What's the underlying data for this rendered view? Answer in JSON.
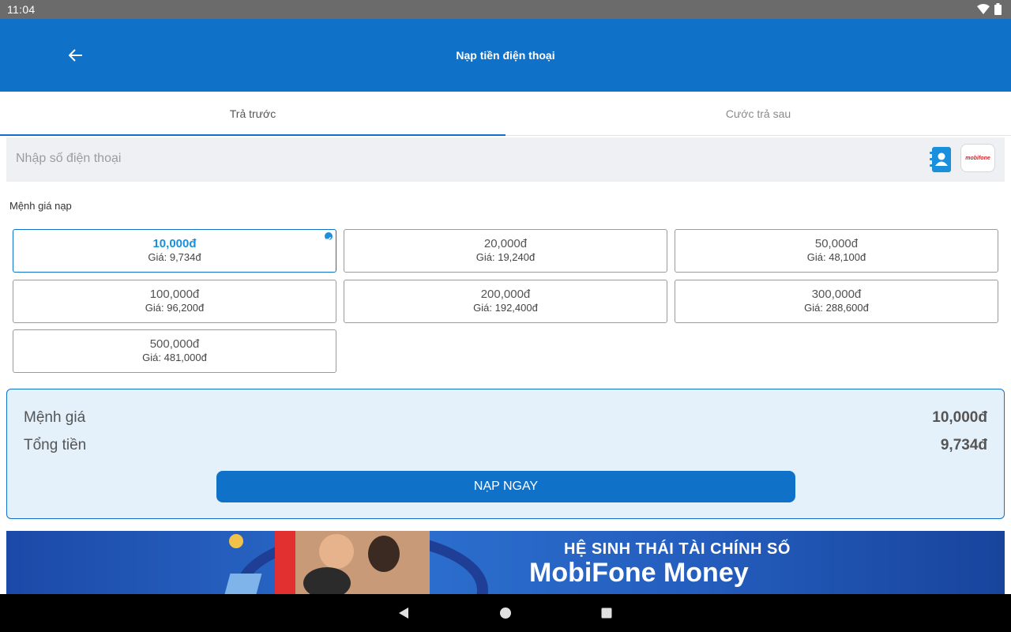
{
  "status": {
    "time": "11:04"
  },
  "header": {
    "title": "Nạp tiền điện thoại"
  },
  "tabs": [
    {
      "label": "Trả trước",
      "active": true
    },
    {
      "label": "Cước trả sau",
      "active": false
    }
  ],
  "phone": {
    "placeholder": "Nhập số điện thoại",
    "operator_logo_text": "mobifone"
  },
  "denominations": {
    "title": "Mệnh giá nạp",
    "items": [
      {
        "amount": "10,000đ",
        "price": "Giá: 9,734đ",
        "selected": true
      },
      {
        "amount": "20,000đ",
        "price": "Giá: 19,240đ",
        "selected": false
      },
      {
        "amount": "50,000đ",
        "price": "Giá: 48,100đ",
        "selected": false
      },
      {
        "amount": "100,000đ",
        "price": "Giá: 96,200đ",
        "selected": false
      },
      {
        "amount": "200,000đ",
        "price": "Giá: 192,400đ",
        "selected": false
      },
      {
        "amount": "300,000đ",
        "price": "Giá: 288,600đ",
        "selected": false
      },
      {
        "amount": "500,000đ",
        "price": "Giá: 481,000đ",
        "selected": false
      }
    ]
  },
  "summary": {
    "face_value_label": "Mệnh giá",
    "face_value": "10,000đ",
    "total_label": "Tổng tiền",
    "total": "9,734đ",
    "button_label": "NẠP NGAY"
  },
  "banner": {
    "subtitle": "HỆ SINH THÁI TÀI CHÍNH SỐ",
    "title": "MobiFone Money"
  },
  "colors": {
    "primary": "#1071c8",
    "accent": "#1a8fdc",
    "summary_bg": "#e4f0fa"
  }
}
